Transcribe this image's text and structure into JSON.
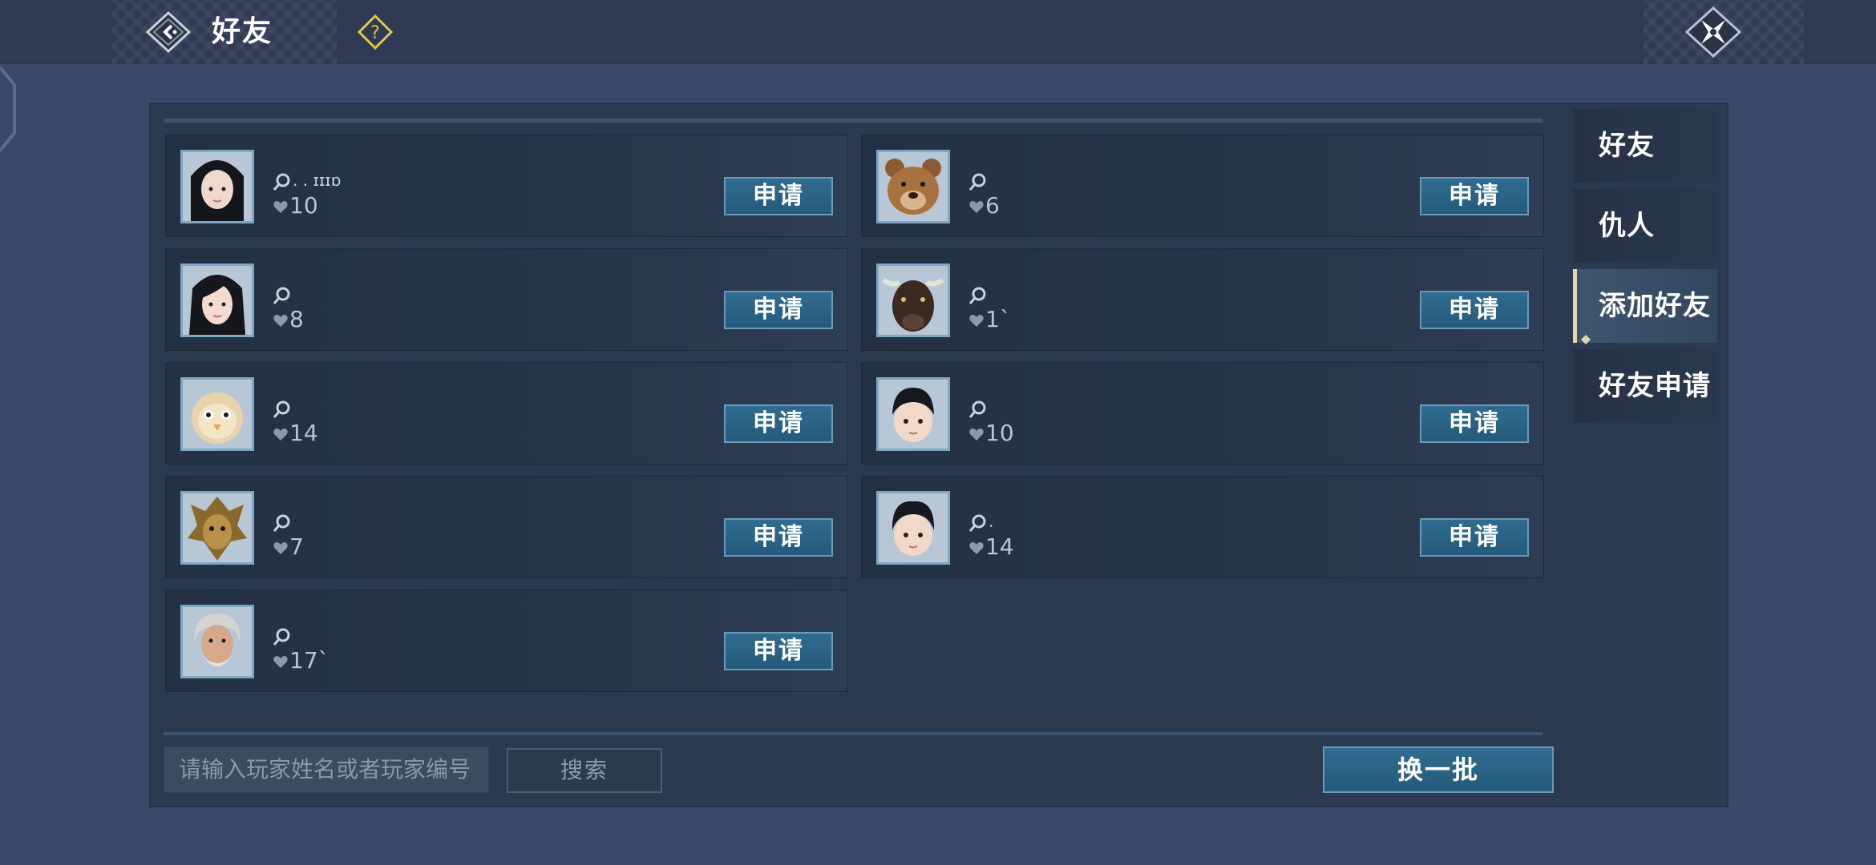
{
  "header": {
    "title": "好友"
  },
  "colors": {
    "background": "#3a4968",
    "topbar": "#2f3a55",
    "panel": "#2b3a50",
    "button_accent": "#2f6c90",
    "active_tab_marker": "#e0d9a6",
    "help_icon": "#e3c64c"
  },
  "icons": {
    "back": "back-arrow-diamond-icon",
    "help": "question-diamond-icon",
    "close": "close-shuriken-icon",
    "level": "magnifier-level-icon",
    "heart": "heart-icon"
  },
  "players": [
    {
      "name": ". . ɪɪɪɒ",
      "level": "10",
      "action": "申请",
      "avatar": "female-black-hair-avatar"
    },
    {
      "name": "",
      "level": "6",
      "action": "申请",
      "avatar": "bear-avatar"
    },
    {
      "name": "",
      "level": "8",
      "action": "申请",
      "avatar": "female-long-hair-avatar"
    },
    {
      "name": "",
      "level": "1`",
      "action": "申请",
      "avatar": "ox-avatar"
    },
    {
      "name": "",
      "level": "14",
      "action": "申请",
      "avatar": "chick-avatar"
    },
    {
      "name": "",
      "level": "10",
      "action": "申请",
      "avatar": "child-boy-avatar"
    },
    {
      "name": "",
      "level": "7",
      "action": "申请",
      "avatar": "golden-mask-avatar"
    },
    {
      "name": ".",
      "level": "14",
      "action": "申请",
      "avatar": "child-boy-avatar-2"
    },
    {
      "name": "",
      "level": "17`",
      "action": "申请",
      "avatar": "old-man-avatar"
    }
  ],
  "search": {
    "placeholder": "请输入玩家姓名或者玩家编号",
    "button_label": "搜索"
  },
  "refresh_label": "换一批",
  "side_tabs": [
    {
      "label": "好友",
      "active": false
    },
    {
      "label": "仇人",
      "active": false
    },
    {
      "label": "添加好友",
      "active": true
    },
    {
      "label": "好友申请",
      "active": false
    }
  ]
}
